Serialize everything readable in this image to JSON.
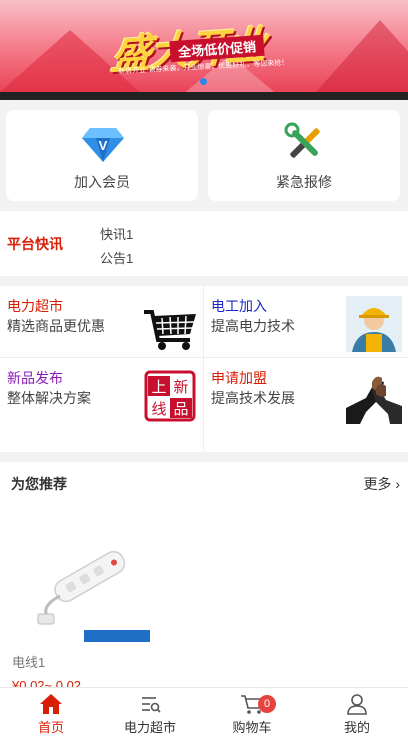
{
  "banner": {
    "headline": "盛大开业",
    "ribbon": "全场低价促销",
    "subline": "新店开业·领券来袭，开业惊喜，优惠好礼，等您来抢！"
  },
  "quick": [
    {
      "label": "加入会员",
      "icon": "vip-diamond-icon"
    },
    {
      "label": "紧急报修",
      "icon": "repair-tools-icon"
    }
  ],
  "news": {
    "title": "平台快讯",
    "items": [
      "快讯1",
      "公告1"
    ]
  },
  "grid": [
    {
      "title": "电力超市",
      "desc": "精选商品更优惠",
      "title_color": "#d81e06",
      "icon": "shopping-cart-icon"
    },
    {
      "title": "电工加入",
      "desc": "提高电力技术",
      "title_color": "#1a2bc8",
      "icon": "electrician-worker-icon"
    },
    {
      "title": "新品发布",
      "desc": "整体解决方案",
      "title_color": "#8a1bb5",
      "icon": "new-product-stamp-icon"
    },
    {
      "title": "申请加盟",
      "desc": "提高技术发展",
      "title_color": "#d81e06",
      "icon": "handshake-icon"
    }
  ],
  "stamp": {
    "a": "上",
    "b": "新",
    "c": "线",
    "d": "品"
  },
  "recommend": {
    "title": "为您推荐",
    "more": "更多",
    "products": [
      {
        "name": "电线1",
        "price": "¥0.02~ 0.02"
      }
    ]
  },
  "tabbar": {
    "items": [
      {
        "label": "首页",
        "icon": "home-icon",
        "active": true
      },
      {
        "label": "电力超市",
        "icon": "market-list-icon",
        "active": false
      },
      {
        "label": "购物车",
        "icon": "cart-icon",
        "active": false,
        "badge": "0"
      },
      {
        "label": "我的",
        "icon": "user-icon",
        "active": false
      }
    ]
  },
  "colors": {
    "accent": "#d81e06",
    "badge": "#e64340"
  }
}
